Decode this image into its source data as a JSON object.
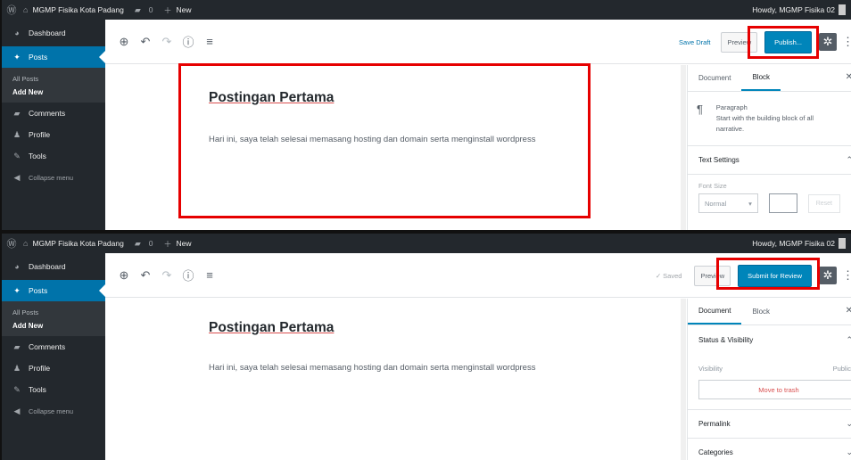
{
  "top": {
    "adminbar": {
      "site_name": "MGMP Fisika Kota Padang",
      "comments_count": "0",
      "new_label": "New",
      "howdy": "Howdy, MGMP Fisika 02"
    },
    "sidebar": {
      "dashboard": "Dashboard",
      "posts": "Posts",
      "all_posts": "All Posts",
      "add_new": "Add New",
      "comments": "Comments",
      "profile": "Profile",
      "tools": "Tools",
      "collapse": "Collapse menu"
    },
    "toolbar": {
      "save_draft": "Save Draft",
      "preview": "Preview",
      "publish": "Publish..."
    },
    "post": {
      "title": "Postingan Pertama",
      "body": "Hari ini, saya telah selesai memasang hosting dan domain serta menginstall wordpress"
    },
    "settings": {
      "tab_document": "Document",
      "tab_block": "Block",
      "active_tab": "Block",
      "block_name": "Paragraph",
      "block_desc": "Start with the building block of all narrative.",
      "text_settings": "Text Settings",
      "font_size_label": "Font Size",
      "font_size_value": "Normal",
      "reset": "Reset"
    }
  },
  "bottom": {
    "adminbar": {
      "site_name": "MGMP Fisika Kota Padang",
      "comments_count": "0",
      "new_label": "New",
      "howdy": "Howdy, MGMP Fisika 02"
    },
    "sidebar": {
      "dashboard": "Dashboard",
      "posts": "Posts",
      "all_posts": "All Posts",
      "add_new": "Add New",
      "comments": "Comments",
      "profile": "Profile",
      "tools": "Tools",
      "collapse": "Collapse menu"
    },
    "toolbar": {
      "saved": "✓ Saved",
      "preview": "Preview",
      "submit": "Submit for Review"
    },
    "post": {
      "title": "Postingan Pertama",
      "body": "Hari ini, saya telah selesai memasang hosting dan domain serta menginstall wordpress"
    },
    "settings": {
      "tab_document": "Document",
      "tab_block": "Block",
      "active_tab": "Document",
      "status_visibility": "Status & Visibility",
      "visibility_label": "Visibility",
      "visibility_value": "Public",
      "move_to_trash": "Move to trash",
      "permalink": "Permalink",
      "categories": "Categories"
    }
  },
  "colors": {
    "admin_bg": "#23282d",
    "accent": "#0073aa",
    "primary_button": "#0085ba",
    "highlight": "#e60000"
  },
  "icons": [
    "wordpress-logo-icon",
    "home-icon",
    "comment-bubble-icon",
    "plus-icon",
    "dashboard-icon",
    "pushpin-icon",
    "user-icon",
    "wrench-icon",
    "collapse-arrow-icon",
    "add-block-icon",
    "undo-icon",
    "redo-icon",
    "info-icon",
    "list-view-icon",
    "gear-icon",
    "more-options-icon",
    "paragraph-icon",
    "close-icon",
    "chevron-icon"
  ]
}
